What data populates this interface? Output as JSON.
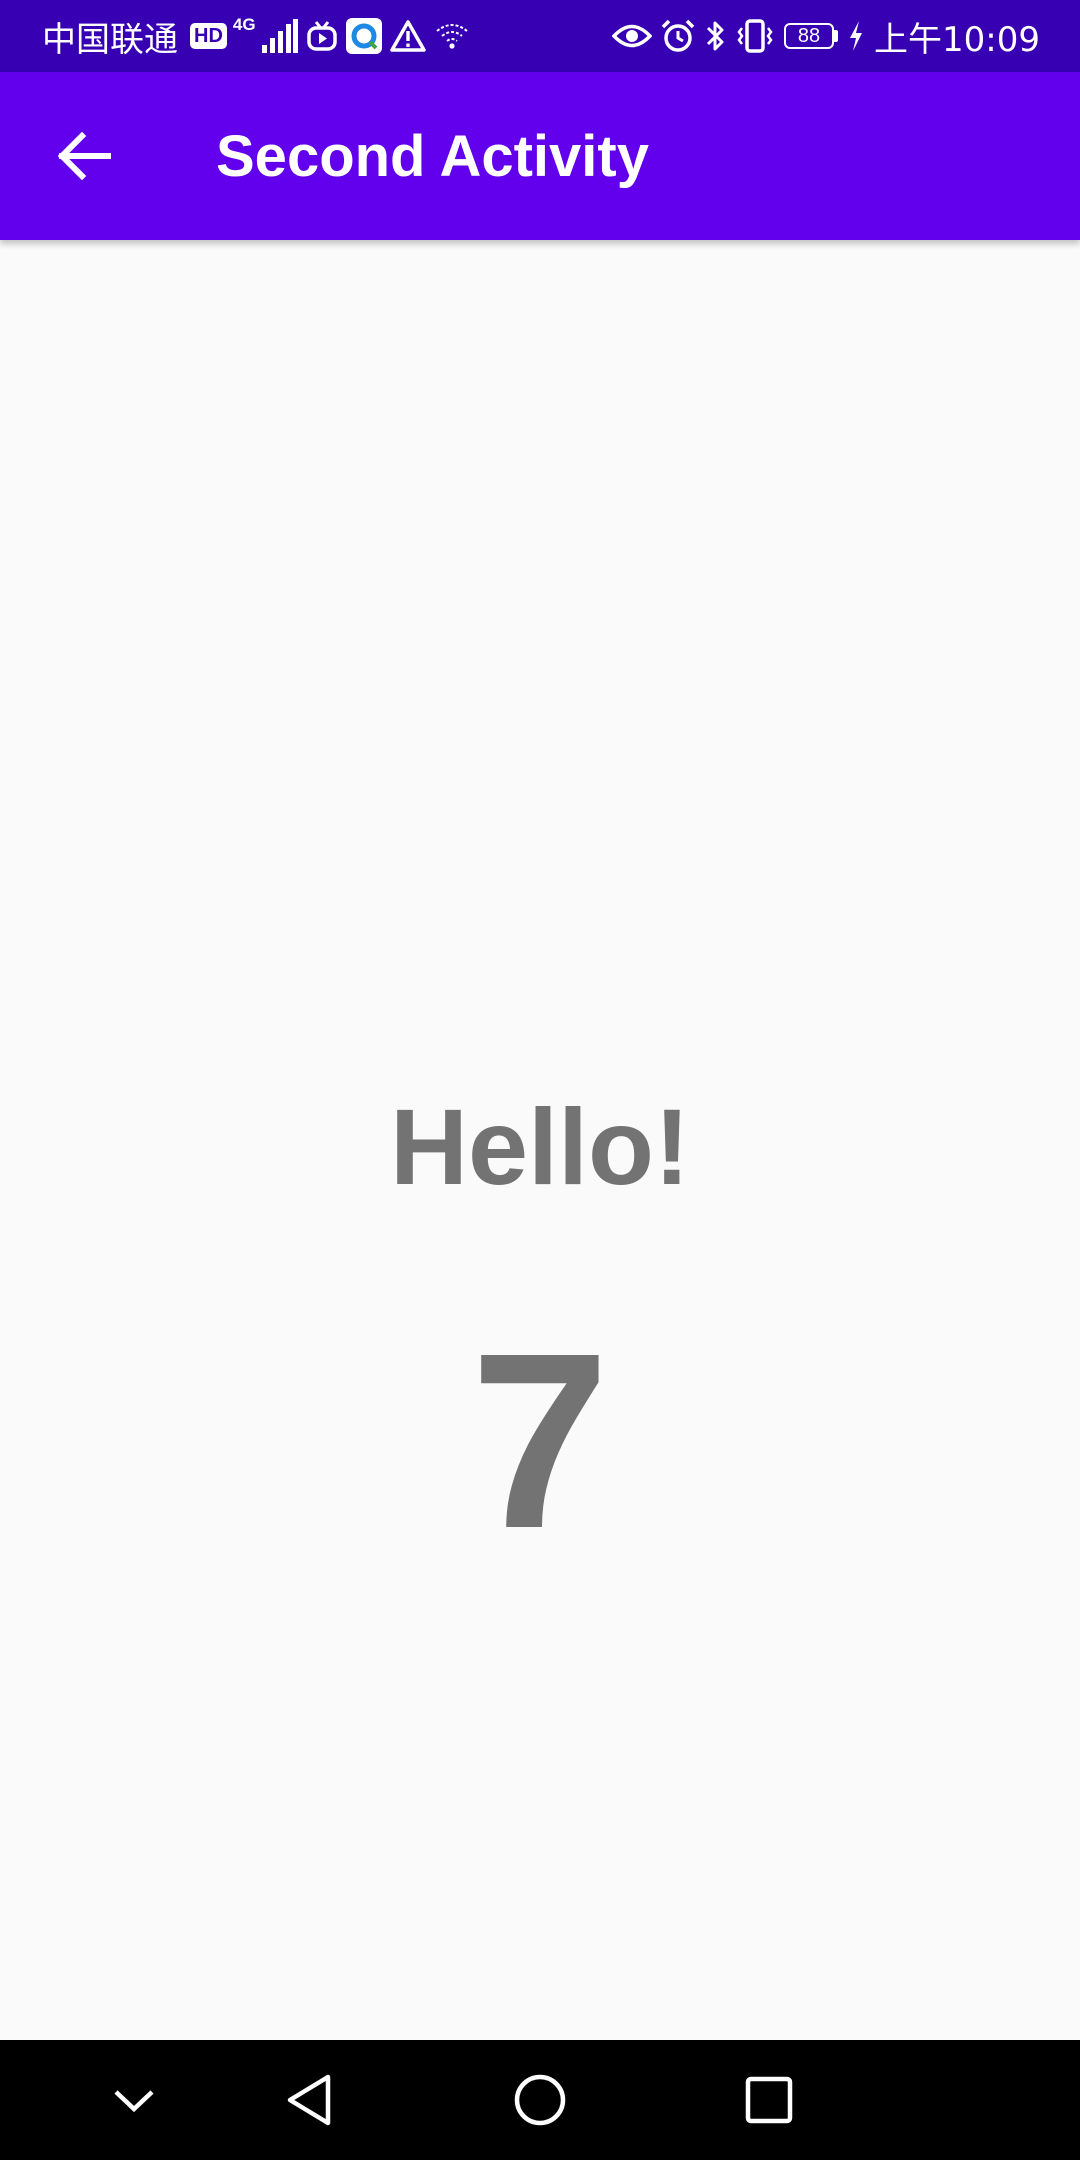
{
  "status_bar": {
    "carrier": "中国联通",
    "hd_badge": "HD",
    "network_type": "4G",
    "battery_level": "88",
    "time": "上午10:09",
    "colors": {
      "background": "#3700b3",
      "foreground": "#ffffff"
    },
    "icons": {
      "left": [
        "hd-icon",
        "signal-icon",
        "tv-icon",
        "browser-app-icon",
        "warning-icon",
        "wifi-icon"
      ],
      "right": [
        "eye-icon",
        "alarm-icon",
        "bluetooth-icon",
        "vibrate-icon",
        "battery-icon",
        "charging-icon"
      ]
    }
  },
  "app_bar": {
    "title": "Second Activity",
    "back_icon": "arrow-left-icon",
    "color": "#6200ee"
  },
  "content": {
    "greeting": "Hello!",
    "count": "7",
    "text_color": "#737373",
    "background": "#fafafa"
  },
  "nav_bar": {
    "buttons": [
      "chevron-down-icon",
      "back-triangle-icon",
      "home-circle-icon",
      "recents-square-icon"
    ],
    "background": "#000000"
  }
}
